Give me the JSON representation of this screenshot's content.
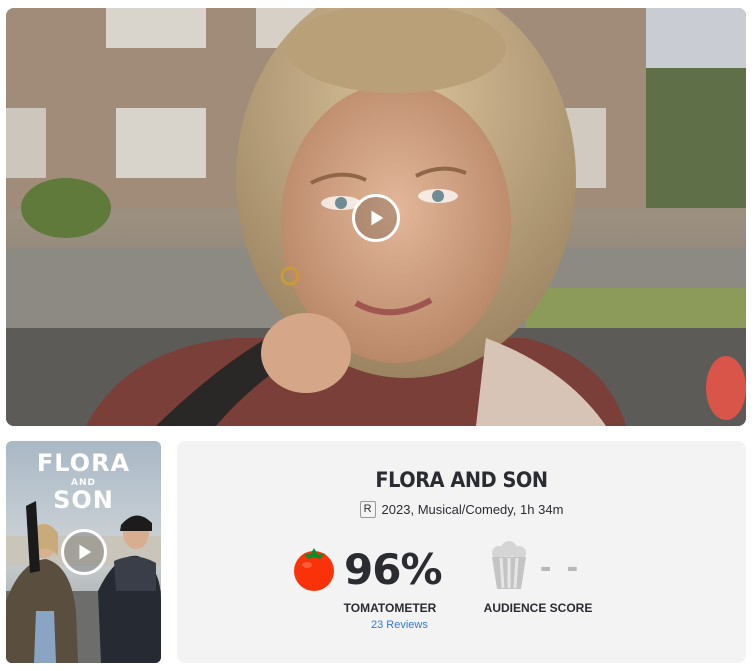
{
  "hero": {
    "play_icon": "play-icon"
  },
  "poster": {
    "title_line1": "FLORA",
    "title_line2": "AND",
    "title_line3": "SON",
    "play_icon": "play-icon"
  },
  "movie": {
    "title": "FLORA AND SON",
    "rating": "R",
    "info": "2023, Musical/Comedy, 1h 34m"
  },
  "tomatometer": {
    "icon": "tomato-icon",
    "score": "96%",
    "label": "TOMATOMETER",
    "reviews": "23 Reviews"
  },
  "audience": {
    "icon": "popcorn-icon",
    "score": "- -",
    "label": "AUDIENCE SCORE"
  },
  "colors": {
    "tomato_red": "#fa320a",
    "link_blue": "#3976dc",
    "panel_bg": "#f3f3f3"
  }
}
